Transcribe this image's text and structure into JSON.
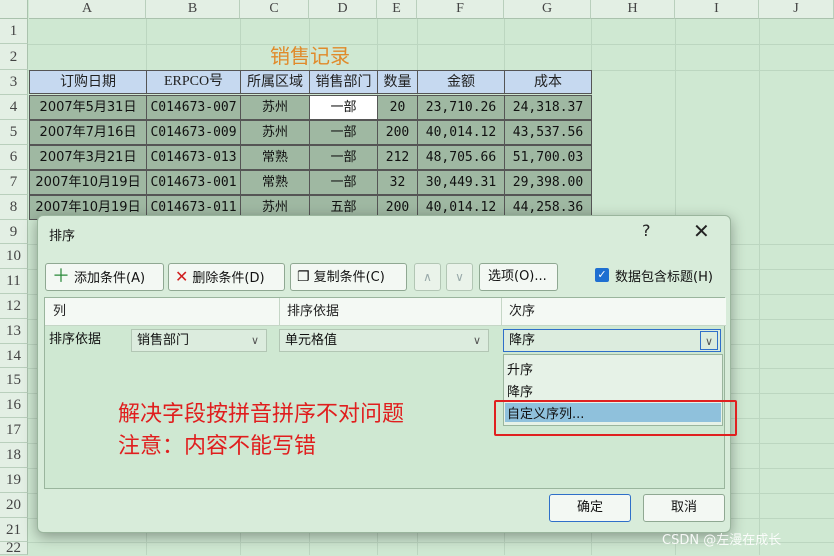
{
  "columns": [
    "A",
    "B",
    "C",
    "D",
    "E",
    "F",
    "G",
    "H",
    "I",
    "J"
  ],
  "rows": [
    "1",
    "2",
    "3",
    "4",
    "5",
    "6",
    "7",
    "8",
    "9",
    "10",
    "11",
    "12",
    "13",
    "14",
    "15",
    "16",
    "17",
    "18",
    "19",
    "20",
    "21",
    "22"
  ],
  "sheet": {
    "title": "销售记录",
    "headers": [
      "订购日期",
      "ERPCO号",
      "所属区域",
      "销售部门",
      "数量",
      "金额",
      "成本"
    ],
    "data": [
      [
        "2007年5月31日",
        "C014673-007",
        "苏州",
        "一部",
        "20",
        "23,710.26",
        "24,318.37"
      ],
      [
        "2007年7月16日",
        "C014673-009",
        "苏州",
        "一部",
        "200",
        "40,014.12",
        "43,537.56"
      ],
      [
        "2007年3月21日",
        "C014673-013",
        "常熟",
        "一部",
        "212",
        "48,705.66",
        "51,700.03"
      ],
      [
        "2007年10月19日",
        "C014673-001",
        "常熟",
        "一部",
        "32",
        "30,449.31",
        "29,398.00"
      ],
      [
        "2007年10月19日",
        "C014673-011",
        "苏州",
        "五部",
        "200",
        "40,014.12",
        "44,258.36"
      ]
    ]
  },
  "dialog": {
    "title": "排序",
    "help": "?",
    "close": "✕",
    "add_condition": "添加条件(A)",
    "delete_condition": "删除条件(D)",
    "copy_condition": "复制条件(C)",
    "up": "∧",
    "down": "∨",
    "options": "选项(O)...",
    "has_header_label": "数据包含标题(H)",
    "has_header_checked": true,
    "col_header": "列",
    "basis_header": "排序依据",
    "order_header": "次序",
    "row_label": "排序依据",
    "column_value": "销售部门",
    "basis_value": "单元格值",
    "order_value": "降序",
    "order_options": [
      "升序",
      "降序",
      "自定义序列..."
    ],
    "highlighted_option": "自定义序列...",
    "ok": "确定",
    "cancel": "取消"
  },
  "annotation": {
    "line1": "解决字段按拼音拼序不对问题",
    "line2": "注意：内容不能写错",
    "color": "#e01e1e"
  },
  "watermark": "CSDN @左漫在成长"
}
